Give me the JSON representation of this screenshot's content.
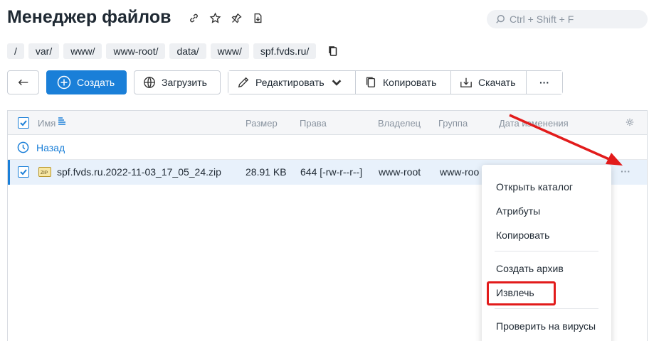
{
  "header": {
    "title": "Менеджер файлов"
  },
  "search": {
    "placeholder": "Ctrl + Shift + F"
  },
  "breadcrumbs": [
    "/",
    "var/",
    "www/",
    "www-root/",
    "data/",
    "www/",
    "spf.fvds.ru/"
  ],
  "toolbar": {
    "create": "Создать",
    "upload": "Загрузить",
    "edit": "Редактировать",
    "copy": "Копировать",
    "download": "Скачать",
    "more": "···"
  },
  "table": {
    "columns": {
      "name": "Имя",
      "size": "Размер",
      "perms": "Права",
      "owner": "Владелец",
      "group": "Группа",
      "modified": "Дата изменения"
    },
    "back_label": "Назад",
    "rows": [
      {
        "icon": "zip-file-icon",
        "name": "spf.fvds.ru.2022-11-03_17_05_24.zip",
        "size": "28.91 KB",
        "perms": "644 [-rw-r--r--]",
        "owner": "www-root",
        "group": "www-roo",
        "more": "···",
        "selected": true
      }
    ]
  },
  "context_menu": {
    "items": [
      "Открыть каталог",
      "Атрибуты",
      "Копировать",
      "Создать архив",
      "Извлечь",
      "Проверить на вирусы"
    ],
    "highlighted": "Извлечь"
  },
  "colors": {
    "accent": "#1a7fd8",
    "annotation": "#e21b1b"
  }
}
